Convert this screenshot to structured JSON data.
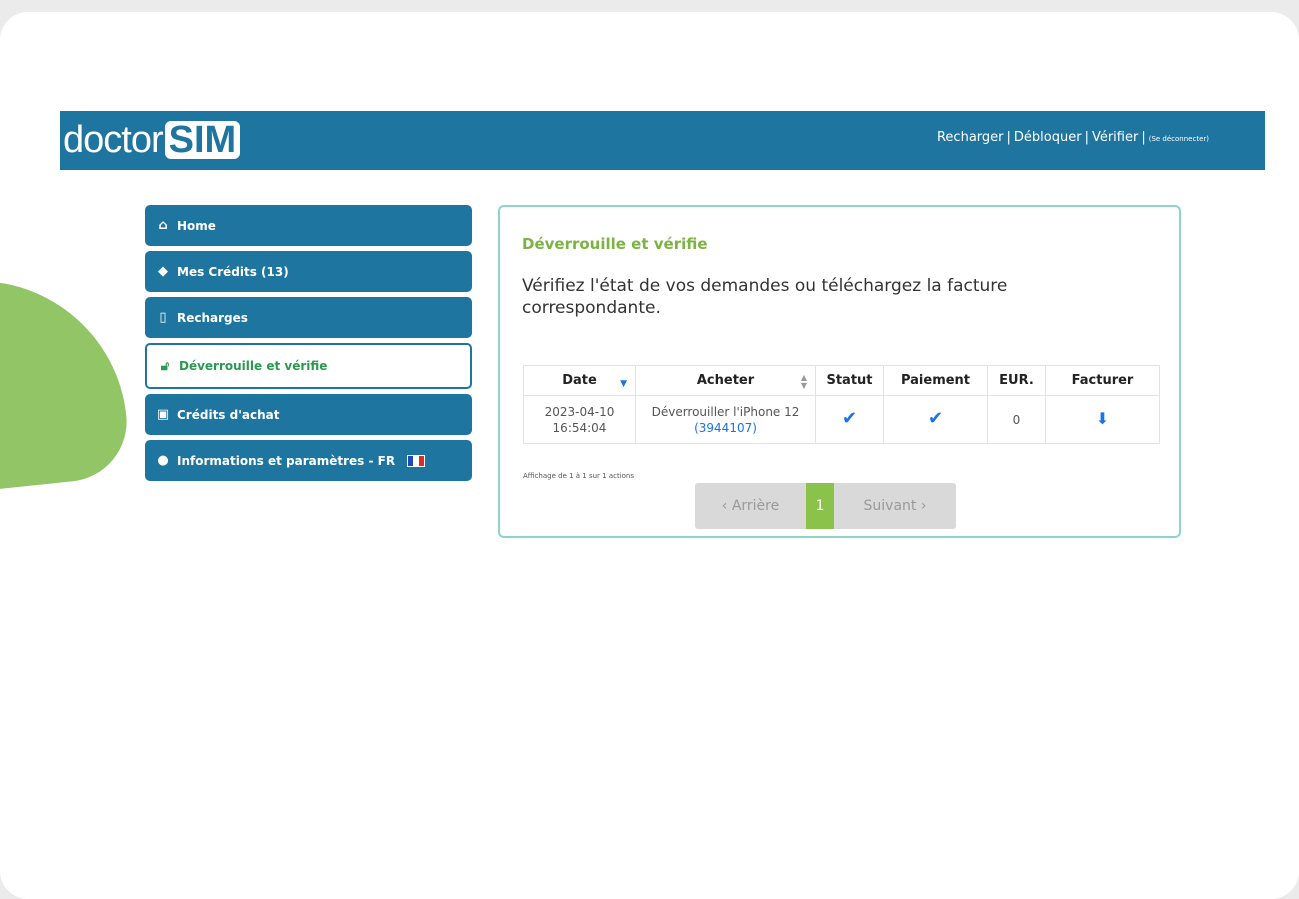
{
  "brand": {
    "logo_text": "doctor",
    "logo_box": "SIM"
  },
  "topnav": {
    "recharger": "Recharger",
    "debloquer": "Débloquer",
    "verifier": "Vérifier",
    "separator": "|",
    "logout": "(Se déconnecter)"
  },
  "sidebar": {
    "items": [
      {
        "label": "Home",
        "icon": "home-icon"
      },
      {
        "label": "Mes Crédits (13)",
        "icon": "tags-icon"
      },
      {
        "label": "Recharges",
        "icon": "mobile-icon"
      },
      {
        "label": "Déverrouille et vérifie",
        "icon": "unlock-icon",
        "active": true
      },
      {
        "label": "Crédits d'achat",
        "icon": "money-icon"
      },
      {
        "label": "Informations et paramètres - FR",
        "icon": "user-icon"
      }
    ]
  },
  "panel": {
    "title": "Déverrouille et vérifie",
    "description": "Vérifiez l'état de vos demandes ou téléchargez la facture correspondante."
  },
  "table": {
    "headers": [
      "Date",
      "Acheter",
      "Statut",
      "Paiement",
      "EUR.",
      "Facturer"
    ],
    "rows": [
      {
        "date": "2023-04-10",
        "time": "16:54:04",
        "product": "Déverrouiller l'iPhone 12",
        "order_id": "(3944107)",
        "eur": "0"
      }
    ]
  },
  "table_info": "Affichage de 1 à 1 sur 1 actions",
  "pagination": {
    "prev": "‹  Arrière",
    "current": "1",
    "next": "Suivant  ›"
  },
  "colors": {
    "primary": "#1e76a0",
    "accent_green": "#7cb342",
    "link": "#1a73e8"
  }
}
